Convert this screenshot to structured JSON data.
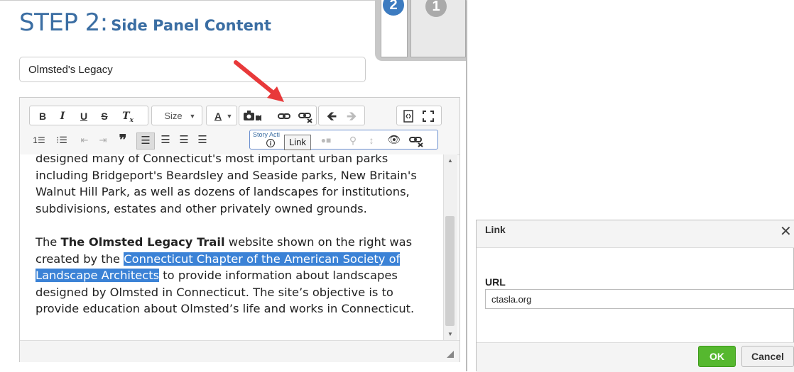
{
  "step": {
    "label": "STEP 2:",
    "subtitle": "Side Panel Content",
    "tabs": [
      "2",
      "1"
    ]
  },
  "title_field": {
    "value": "Olmsted's Legacy"
  },
  "toolbar": {
    "size_label": "Size",
    "story_label": "Story Acti",
    "tooltip": "Link"
  },
  "content": {
    "p1": "designed many of Connecticut's most important urban parks including Bridgeport's Beardsley and Seaside parks, New Britain's Walnut Hill Park, as well as dozens of landscapes for institutions, subdivisions, estates and other privately owned grounds.",
    "p2_a": "The ",
    "p2_bold": "The Olmsted Legacy Trail",
    "p2_b": " website shown on the right was created by the ",
    "p2_link": "Connecticut Chapter of the American Society of Landscape Architects",
    "p2_c": " to provide information about landscapes designed by Olmsted in Connecticut. The site’s objective is to provide education about Olmsted’s life and works in Connecticut."
  },
  "dialog": {
    "title": "Link",
    "url_label": "URL",
    "url_value": "ctasla.org",
    "ok_label": "OK",
    "cancel_label": "Cancel"
  },
  "colors": {
    "accent": "#3b6ea3",
    "selection": "#3b82d6",
    "ok": "#56b82f",
    "arrow": "#e8393a"
  }
}
